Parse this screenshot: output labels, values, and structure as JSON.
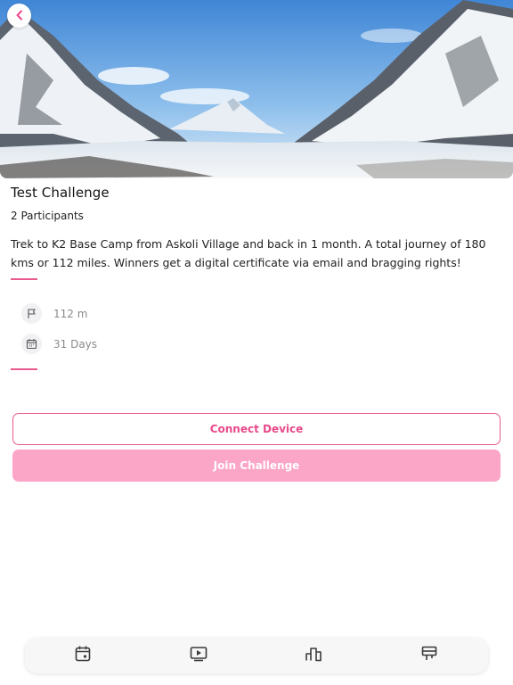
{
  "challenge": {
    "title": "Test Challenge",
    "participants": "2 Participants",
    "description": "Trek to K2 Base Camp from Askoli Village and back in 1 month. A total journey of 180 kms or 112 miles. Winners get a digital certificate via email and bragging rights!"
  },
  "stats": [
    {
      "icon": "flag-icon",
      "value": "112 m"
    },
    {
      "icon": "calendar-icon",
      "value": "31 Days"
    }
  ],
  "buttons": {
    "connect_label": "Connect Device",
    "join_label": "Join Challenge"
  },
  "nav": {
    "items": [
      {
        "icon": "calendar-icon"
      },
      {
        "icon": "video-icon"
      },
      {
        "icon": "leaderboard-icon"
      },
      {
        "icon": "board-icon"
      }
    ]
  },
  "colors": {
    "accent": "#e8598f",
    "join_button": "#fba5c7"
  }
}
